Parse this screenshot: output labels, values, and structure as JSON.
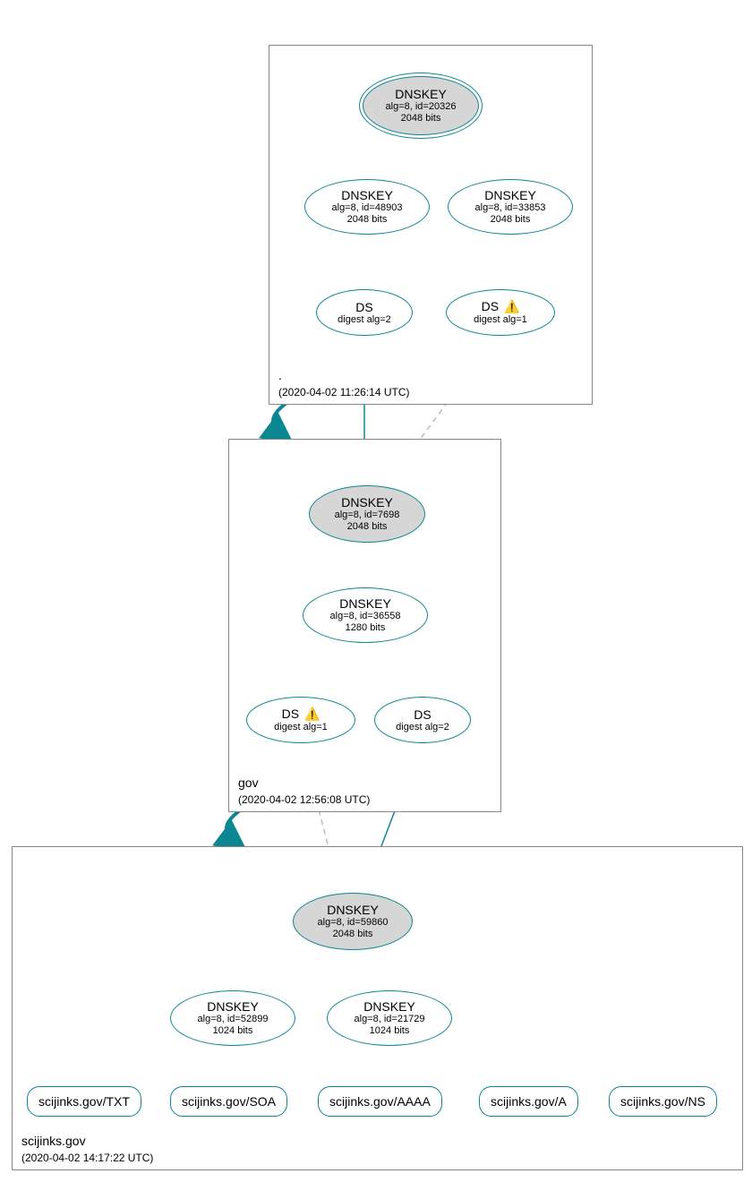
{
  "zones": {
    "root": {
      "label": ".",
      "timestamp": "(2020-04-02 11:26:14 UTC)",
      "nodes": {
        "ksk": {
          "title": "DNSKEY",
          "line1": "alg=8, id=20326",
          "line2": "2048 bits"
        },
        "zsk1": {
          "title": "DNSKEY",
          "line1": "alg=8, id=48903",
          "line2": "2048 bits"
        },
        "zsk2": {
          "title": "DNSKEY",
          "line1": "alg=8, id=33853",
          "line2": "2048 bits"
        },
        "ds1": {
          "title": "DS",
          "line1": "digest alg=2"
        },
        "ds2": {
          "title": "DS",
          "line1": "digest alg=1",
          "warn": true
        }
      }
    },
    "gov": {
      "label": "gov",
      "timestamp": "(2020-04-02 12:56:08 UTC)",
      "nodes": {
        "ksk": {
          "title": "DNSKEY",
          "line1": "alg=8, id=7698",
          "line2": "2048 bits"
        },
        "zsk": {
          "title": "DNSKEY",
          "line1": "alg=8, id=36558",
          "line2": "1280 bits"
        },
        "ds1": {
          "title": "DS",
          "line1": "digest alg=1",
          "warn": true
        },
        "ds2": {
          "title": "DS",
          "line1": "digest alg=2"
        }
      }
    },
    "scijinks": {
      "label": "scijinks.gov",
      "timestamp": "(2020-04-02 14:17:22 UTC)",
      "nodes": {
        "ksk": {
          "title": "DNSKEY",
          "line1": "alg=8, id=59860",
          "line2": "2048 bits"
        },
        "zsk1": {
          "title": "DNSKEY",
          "line1": "alg=8, id=52899",
          "line2": "1024 bits"
        },
        "zsk2": {
          "title": "DNSKEY",
          "line1": "alg=8, id=21729",
          "line2": "1024 bits"
        }
      },
      "records": {
        "txt": "scijinks.gov/TXT",
        "soa": "scijinks.gov/SOA",
        "aaaa": "scijinks.gov/AAAA",
        "a": "scijinks.gov/A",
        "ns": "scijinks.gov/NS"
      }
    }
  },
  "icons": {
    "warning": "⚠️"
  },
  "colors": {
    "edge": "#0b8793",
    "dashed": "#bcbcbc"
  }
}
